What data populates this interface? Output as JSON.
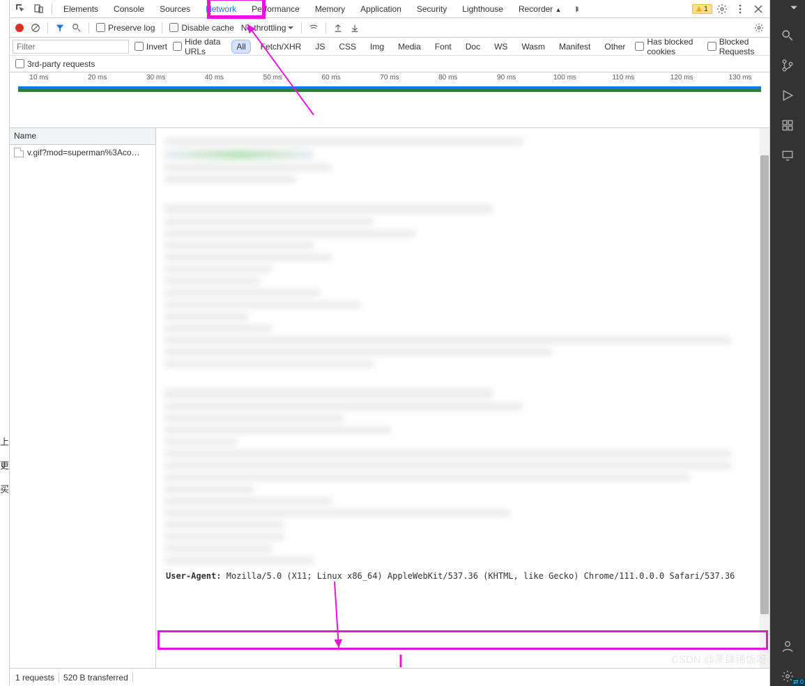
{
  "tabstrip": {
    "tabs": [
      "Elements",
      "Console",
      "Sources",
      "Network",
      "Performance",
      "Memory",
      "Application",
      "Security",
      "Lighthouse",
      "Recorder"
    ],
    "active_index": 3,
    "warn_count": "1"
  },
  "toolbar2": {
    "preserve_log": "Preserve log",
    "disable_cache": "Disable cache",
    "throttling": "No throttling"
  },
  "toolbar3": {
    "filter_placeholder": "Filter",
    "invert": "Invert",
    "hide_data_urls": "Hide data URLs",
    "filter_tabs": [
      "All",
      "Fetch/XHR",
      "JS",
      "CSS",
      "Img",
      "Media",
      "Font",
      "Doc",
      "WS",
      "Wasm",
      "Manifest",
      "Other"
    ],
    "blocked_cookies": "Has blocked cookies",
    "blocked_requests": "Blocked Requests"
  },
  "toolbar4": {
    "third_party": "3rd-party requests"
  },
  "timeline": {
    "ticks": [
      "10 ms",
      "20 ms",
      "30 ms",
      "40 ms",
      "50 ms",
      "60 ms",
      "70 ms",
      "80 ms",
      "90 ms",
      "100 ms",
      "110 ms",
      "120 ms",
      "130 ms"
    ]
  },
  "reqlist": {
    "header": "Name",
    "rows": [
      "v.gif?mod=superman%3Aco…"
    ]
  },
  "detail": {
    "ua_key": "User-Agent:",
    "ua_val": "Mozilla/5.0 (X11; Linux x86_64) AppleWebKit/537.36 (KHTML, like Gecko) Chrome/111.0.0.0 Safari/537.36"
  },
  "statusbar": {
    "requests": "1 requests",
    "transferred": "520 B transferred"
  },
  "right_badge": "0",
  "watermark": "CSDN @蔗肆稀饭呀",
  "left_chars": [
    "上",
    "更",
    "买"
  ]
}
